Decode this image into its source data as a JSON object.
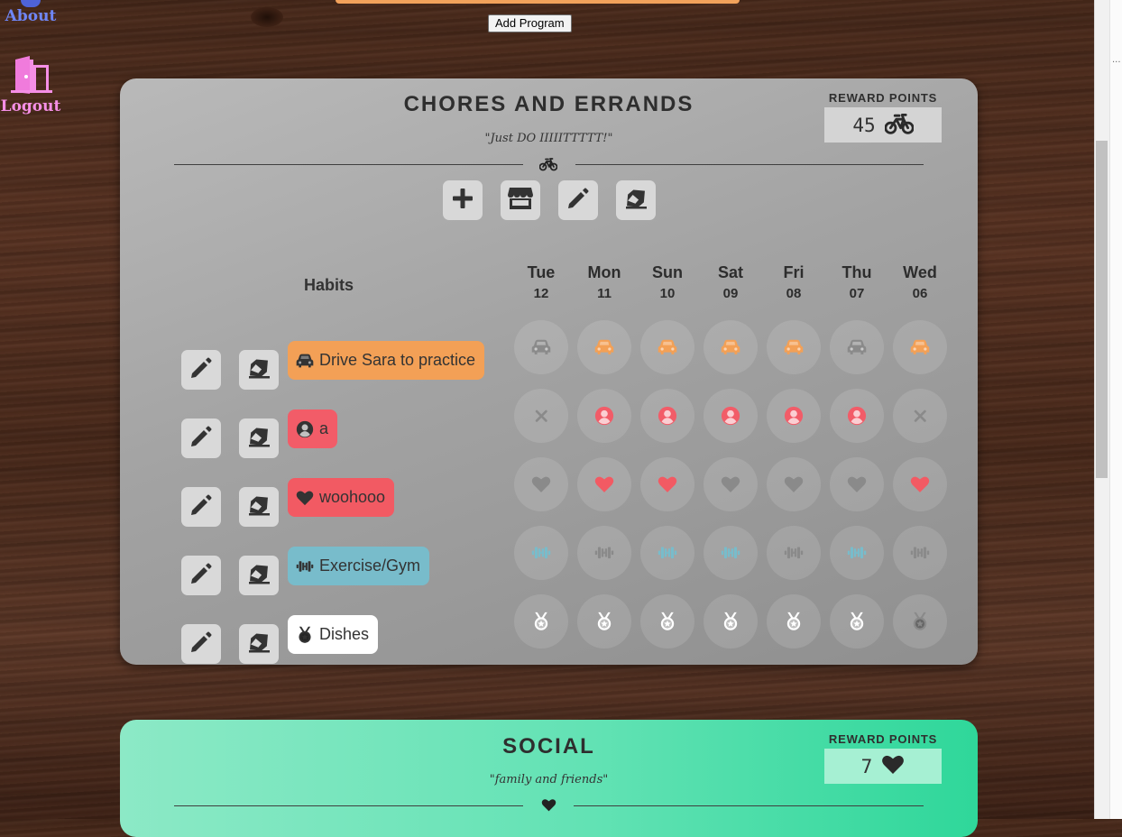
{
  "nav": {
    "about_label": "About",
    "logout_label": "Logout"
  },
  "toolbar": {
    "add_program_label": "Add Program"
  },
  "chores": {
    "title": "CHORES AND ERRANDS",
    "motto": "\"Just DO IIIIITTTTT!\"",
    "reward_label": "REWARD POINTS",
    "reward_value": "45",
    "reward_icon": "bicycle-icon",
    "tools": [
      "plus-icon",
      "store-icon",
      "pencil-icon",
      "eraser-icon"
    ],
    "habits_header": "Habits",
    "days": [
      {
        "name": "Tue",
        "num": "12"
      },
      {
        "name": "Mon",
        "num": "11"
      },
      {
        "name": "Sun",
        "num": "10"
      },
      {
        "name": "Sat",
        "num": "09"
      },
      {
        "name": "Fri",
        "num": "08"
      },
      {
        "name": "Thu",
        "num": "07"
      },
      {
        "name": "Wed",
        "num": "06"
      }
    ],
    "habits": [
      {
        "label": "Drive Sara to practice",
        "icon": "car-icon",
        "color": "#f3a056",
        "done": [
          false,
          true,
          true,
          true,
          true,
          false,
          true
        ]
      },
      {
        "label": "a",
        "icon": "user-circle-icon",
        "color": "#f25c68",
        "done": [
          false,
          true,
          true,
          true,
          true,
          true,
          false
        ],
        "missed": [
          true,
          false,
          false,
          false,
          false,
          false,
          true
        ]
      },
      {
        "label": "woohooo",
        "icon": "heart-icon",
        "color": "#f25a63",
        "done": [
          false,
          true,
          true,
          false,
          false,
          false,
          true
        ]
      },
      {
        "label": "Exercise/Gym",
        "icon": "dumbbell-icon",
        "color": "#78bccb",
        "done": [
          true,
          false,
          true,
          true,
          false,
          true,
          false
        ]
      },
      {
        "label": "Dishes",
        "icon": "medal-icon",
        "color": "#ffffff",
        "done": [
          true,
          true,
          true,
          true,
          true,
          true,
          false
        ]
      }
    ]
  },
  "social": {
    "title": "SOCIAL",
    "motto": "\"family and friends\"",
    "reward_label": "REWARD POINTS",
    "reward_value": "7",
    "reward_icon": "heart-icon"
  },
  "colors": {
    "done_icon": "#ffffff",
    "pending_icon": "#8a8a8a",
    "about": "#6f86f5",
    "logout": "#f58fe6"
  }
}
